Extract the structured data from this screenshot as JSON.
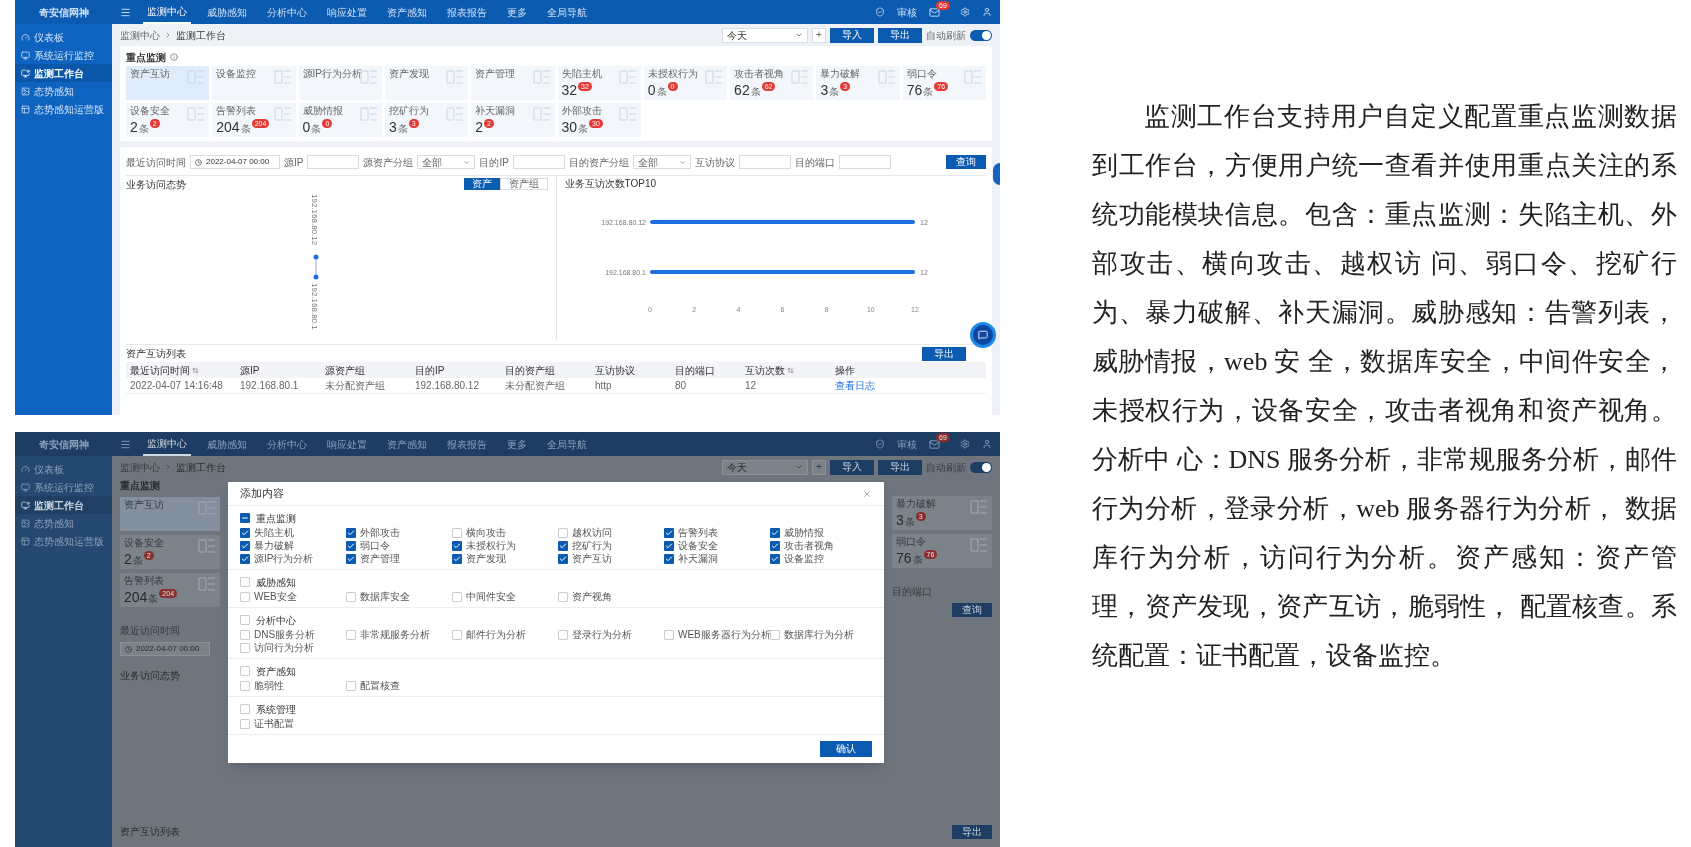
{
  "top_screen": {
    "brand": "奇安信网神",
    "nav": [
      {
        "label": "监测中心",
        "selected": true
      },
      {
        "label": "威胁感知",
        "selected": false
      },
      {
        "label": "分析中心",
        "selected": false
      },
      {
        "label": "响应处置",
        "selected": false
      },
      {
        "label": "资产感知",
        "selected": false
      },
      {
        "label": "报表报告",
        "selected": false
      },
      {
        "label": "更多",
        "selected": false
      },
      {
        "label": "全局导航",
        "selected": false
      }
    ],
    "header_tools": {
      "label": "审核",
      "mail_badge": "69"
    },
    "sidebar": [
      {
        "label": "仪表板",
        "selected": false
      },
      {
        "label": "系统运行监控",
        "selected": false
      },
      {
        "label": "监测工作台",
        "selected": true
      },
      {
        "label": "态势感知",
        "selected": false
      },
      {
        "label": "态势感知运营版",
        "selected": false
      }
    ],
    "breadcrumb": [
      "监测中心",
      "监测工作台"
    ],
    "toolbar": {
      "range": "今天",
      "plus": "+",
      "buttons": [
        "导入",
        "导出"
      ],
      "switch": {
        "label": "自动刷新",
        "on": true
      }
    },
    "key_monitoring": {
      "title": "重点监测",
      "cards": [
        {
          "label": "资产互访",
          "selected": true
        },
        {
          "label": "设备监控",
          "selected": false
        },
        {
          "label": "源IP行为分析",
          "selected": false
        },
        {
          "label": "资产发现",
          "selected": false
        },
        {
          "label": "资产管理",
          "selected": false
        },
        {
          "label": "失陷主机",
          "value": "32",
          "badge": "32",
          "selected": false
        },
        {
          "label": "未授权行为",
          "value": "0",
          "unit": "条",
          "badge": "0",
          "selected": false
        },
        {
          "label": "攻击者视角",
          "value": "62",
          "unit": "条",
          "badge": "62",
          "selected": false
        },
        {
          "label": "暴力破解",
          "value": "3",
          "unit": "条",
          "badge": "3",
          "selected": false
        },
        {
          "label": "弱口令",
          "value": "76",
          "unit": "条",
          "badge": "76",
          "selected": false
        },
        {
          "label": "设备安全",
          "value": "2",
          "unit": "条",
          "badge": "2",
          "selected": false
        },
        {
          "label": "告警列表",
          "value": "204",
          "unit": "条",
          "badge": "204",
          "selected": false
        },
        {
          "label": "威胁情报",
          "value": "0",
          "unit": "条",
          "badge": "0",
          "selected": false
        },
        {
          "label": "挖矿行为",
          "value": "3",
          "unit": "条",
          "badge": "3",
          "selected": false
        },
        {
          "label": "补天漏洞",
          "value": "2",
          "badge": "2",
          "selected": false
        },
        {
          "label": "外部攻击",
          "value": "30",
          "unit": "条",
          "badge": "30",
          "selected": false
        }
      ]
    },
    "filters": [
      {
        "label": "最近访问时间",
        "kind": "date",
        "value": "2022-04-07 00:00"
      },
      {
        "label": "源IP",
        "kind": "text"
      },
      {
        "label": "源资产分组",
        "kind": "select",
        "value": "全部"
      },
      {
        "label": "目的IP",
        "kind": "text"
      },
      {
        "label": "目的资产分组",
        "kind": "select",
        "value": "全部"
      },
      {
        "label": "互访协议",
        "kind": "text"
      },
      {
        "label": "目的端口",
        "kind": "text"
      }
    ],
    "query_button": "查询",
    "access_trend": {
      "title": "业务访问态势",
      "toggle": [
        {
          "label": "资产",
          "selected": true
        },
        {
          "label": "资产组",
          "selected": false
        }
      ],
      "nodes": [
        "192.168.80.12",
        "192.168.80.1"
      ]
    },
    "top10": {
      "title": "业务互访次数TOP10",
      "chart_data": {
        "type": "bar",
        "orientation": "horizontal",
        "categories": [
          "192.168.80.12",
          "192.168.80.1"
        ],
        "series": [
          {
            "color": "#1e6fe0",
            "values": [
              12,
              12
            ]
          }
        ],
        "xlim": [
          0,
          12
        ],
        "xticks": [
          0,
          2,
          4,
          6,
          8,
          10,
          12
        ],
        "data_labels": true
      }
    },
    "table": {
      "title": "资产互访列表",
      "export_button": "导出",
      "columns": [
        {
          "label": "最近访问时间",
          "sortable": true
        },
        {
          "label": "源IP",
          "sortable": false
        },
        {
          "label": "源资产组",
          "sortable": false
        },
        {
          "label": "目的IP",
          "sortable": false
        },
        {
          "label": "目的资产组",
          "sortable": false
        },
        {
          "label": "互访协议",
          "sortable": false
        },
        {
          "label": "目的端口",
          "sortable": false
        },
        {
          "label": "互访次数",
          "sortable": true
        },
        {
          "label": "操作",
          "sortable": false
        }
      ],
      "rows": [
        {
          "cells": [
            "2022-04-07 14:16:48",
            "192.168.80.1",
            "未分配资产组",
            "192.168.80.12",
            "未分配资产组",
            "http",
            "80",
            "12"
          ],
          "action": "查看日志"
        }
      ]
    }
  },
  "bottom_screen": {
    "brand": "奇安信网神",
    "nav": [
      {
        "label": "监测中心",
        "selected": true
      },
      {
        "label": "威胁感知",
        "selected": false
      },
      {
        "label": "分析中心",
        "selected": false
      },
      {
        "label": "响应处置",
        "selected": false
      },
      {
        "label": "资产感知",
        "selected": false
      },
      {
        "label": "报表报告",
        "selected": false
      },
      {
        "label": "更多",
        "selected": false
      },
      {
        "label": "全局导航",
        "selected": false
      }
    ],
    "header_tools": {
      "label": "审核",
      "mail_badge": "69"
    },
    "sidebar": [
      {
        "label": "仪表板",
        "selected": false
      },
      {
        "label": "系统运行监控",
        "selected": false
      },
      {
        "label": "监测工作台",
        "selected": true
      },
      {
        "label": "态势感知",
        "selected": false
      },
      {
        "label": "态势感知运营版",
        "selected": false
      }
    ],
    "breadcrumb": [
      "监测中心",
      "监测工作台"
    ],
    "toolbar": {
      "range": "今天",
      "plus": "+",
      "buttons": [
        "导入",
        "导出"
      ],
      "switch": {
        "label": "自动刷新",
        "on": true
      }
    },
    "left": {
      "title": "重点监测",
      "cards": [
        {
          "label": "资产互访",
          "selected": true
        },
        {
          "label": "设备安全",
          "value": "2",
          "unit": "条",
          "badge": "2",
          "selected": false
        },
        {
          "label": "告警列表",
          "value": "204",
          "unit": "条",
          "badge": "204",
          "selected": false
        }
      ],
      "date_label": "最近访问时间",
      "date_value": "2022-04-07 00:00",
      "trend_title": "业务访问态势",
      "table_title": "资产互访列表"
    },
    "right": {
      "cards": [
        {
          "label": "暴力破解",
          "value": "3",
          "unit": "条",
          "badge": "3",
          "selected": false
        },
        {
          "label": "弱口令",
          "value": "76",
          "unit": "条",
          "badge": "76",
          "selected": false
        }
      ],
      "port_label": "目的端口",
      "query_button": "查询",
      "export_button": "导出"
    },
    "modal": {
      "title": "添加内容",
      "confirm": "确认",
      "groups": [
        {
          "label": "重点监测",
          "indeterminate": true,
          "items": [
            {
              "label": "失陷主机",
              "checked": true
            },
            {
              "label": "外部攻击",
              "checked": true
            },
            {
              "label": "横向攻击",
              "checked": false
            },
            {
              "label": "越权访问",
              "checked": false
            },
            {
              "label": "告警列表",
              "checked": true
            },
            {
              "label": "威胁情报",
              "checked": true
            },
            {
              "label": "暴力破解",
              "checked": true
            },
            {
              "label": "弱口令",
              "checked": true
            },
            {
              "label": "未授权行为",
              "checked": true
            },
            {
              "label": "挖矿行为",
              "checked": true
            },
            {
              "label": "设备安全",
              "checked": true
            },
            {
              "label": "攻击者视角",
              "checked": true
            },
            {
              "label": "源IP行为分析",
              "checked": true
            },
            {
              "label": "资产管理",
              "checked": true
            },
            {
              "label": "资产发现",
              "checked": true
            },
            {
              "label": "资产互访",
              "checked": true
            },
            {
              "label": "补天漏洞",
              "checked": true
            },
            {
              "label": "设备监控",
              "checked": true
            }
          ]
        },
        {
          "label": "威胁感知",
          "indeterminate": false,
          "items": [
            {
              "label": "WEB安全",
              "checked": false
            },
            {
              "label": "数据库安全",
              "checked": false
            },
            {
              "label": "中间件安全",
              "checked": false
            },
            {
              "label": "资产视角",
              "checked": false
            }
          ]
        },
        {
          "label": "分析中心",
          "indeterminate": false,
          "items": [
            {
              "label": "DNS服务分析",
              "checked": false
            },
            {
              "label": "非常规服务分析",
              "checked": false
            },
            {
              "label": "邮件行为分析",
              "checked": false
            },
            {
              "label": "登录行为分析",
              "checked": false
            },
            {
              "label": "WEB服务器行为分析",
              "checked": false
            },
            {
              "label": "数据库行为分析",
              "checked": false
            },
            {
              "label": "访问行为分析",
              "checked": false
            }
          ]
        },
        {
          "label": "资产感知",
          "indeterminate": false,
          "items": [
            {
              "label": "脆弱性",
              "checked": false
            },
            {
              "label": "配置核查",
              "checked": false
            }
          ]
        },
        {
          "label": "系统管理",
          "indeterminate": false,
          "items": [
            {
              "label": "证书配置",
              "checked": false
            }
          ]
        }
      ]
    }
  },
  "description": "监测工作台支持用户自定义配置重点监测数据到工作台，方便用户统一查看并使用重点关注的系统功能模块信息。包含：重点监测：失陷主机、外部攻击、横向攻击、越权访 问、弱口令、挖矿行为、暴力破解、补天漏洞。威胁感知：告警列表，威胁情报，web 安 全，数据库安全，中间件安全，未授权行为，设备安全，攻击者视角和资产视角。分析中 心：DNS 服务分析，非常规服务分析，邮件行为分析，登录分析，web 服务器行为分析， 数据库行为分析，访问行为分析。资产感知：资产管理，资产发现，资产互访，脆弱性， 配置核查。系统配置：证书配置，设备监控。"
}
